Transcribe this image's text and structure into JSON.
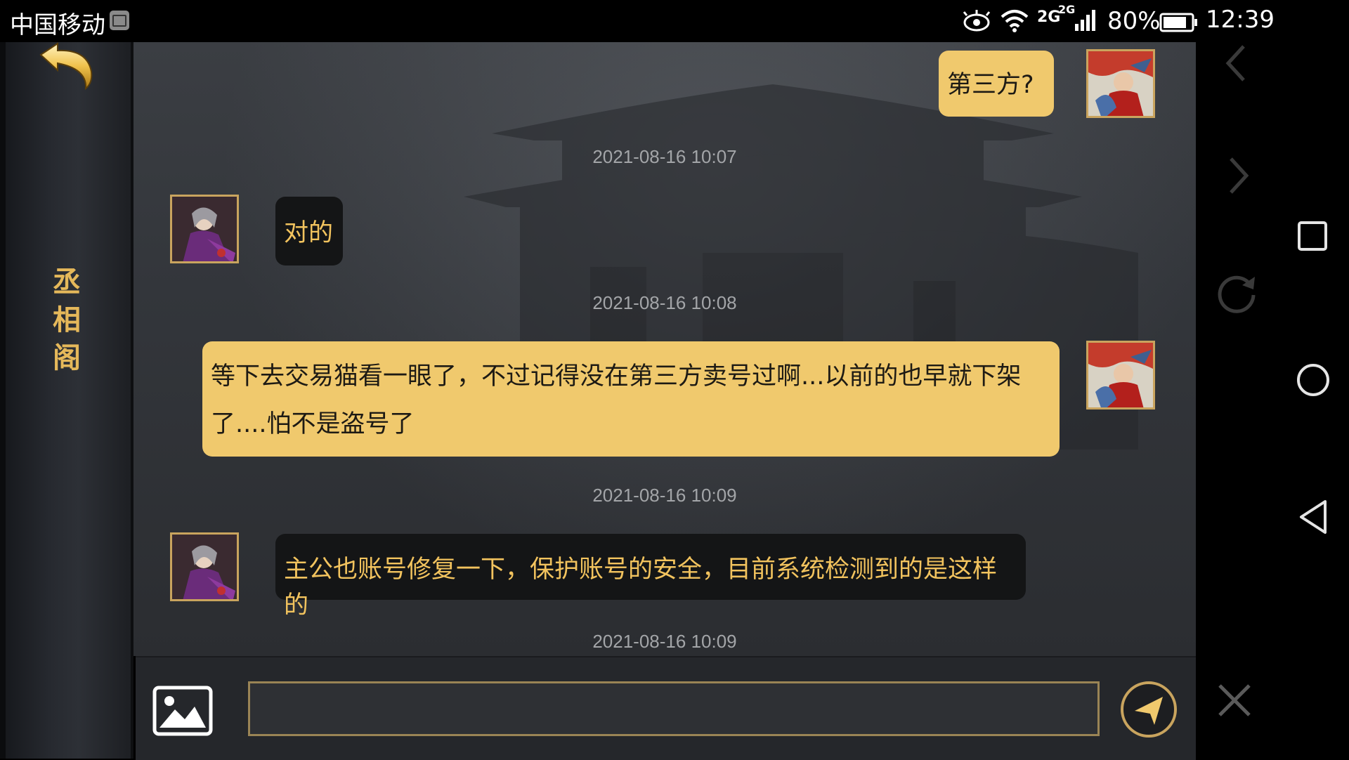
{
  "status_bar": {
    "carrier": "中国移动",
    "network_1": "2G",
    "network_2": "2G",
    "battery": "80%",
    "time": "12:39",
    "icons": [
      "sim-card-icon",
      "eye-icon",
      "wifi-icon",
      "signal-icon",
      "battery-icon"
    ]
  },
  "sidebar": {
    "title": "丞相阁",
    "back_icon": "back-arrow-icon"
  },
  "messages": [
    {
      "type": "message",
      "side": "right",
      "text": "第三方?",
      "avatar": "player-avatar"
    },
    {
      "type": "timestamp",
      "text": "2021-08-16 10:07"
    },
    {
      "type": "message",
      "side": "left",
      "text": "对的",
      "avatar": "advisor-avatar"
    },
    {
      "type": "timestamp",
      "text": "2021-08-16 10:08"
    },
    {
      "type": "message",
      "side": "right",
      "text": "等下去交易猫看一眼了，不过记得没在第三方卖号过啊...以前的也早就下架了....怕不是盗号了",
      "avatar": "player-avatar"
    },
    {
      "type": "timestamp",
      "text": "2021-08-16 10:09"
    },
    {
      "type": "message",
      "side": "left",
      "text": "主公也账号修复一下，保护账号的安全，目前系统检测到的是这样的",
      "avatar": "advisor-avatar"
    },
    {
      "type": "timestamp",
      "text": "2021-08-16 10:09"
    }
  ],
  "input_bar": {
    "value": "",
    "placeholder": "",
    "image_button_icon": "image-icon",
    "send_button_icon": "send-icon"
  },
  "nav_bar": {
    "icons": [
      "chevron-left-icon",
      "chevron-right-icon",
      "square-icon",
      "refresh-icon",
      "home-circle-icon",
      "back-triangle-icon",
      "close-icon"
    ]
  },
  "colors": {
    "accent_gold": "#f0c96d",
    "their_text": "#f2c35e",
    "sidebar_title": "#e5b85a"
  }
}
